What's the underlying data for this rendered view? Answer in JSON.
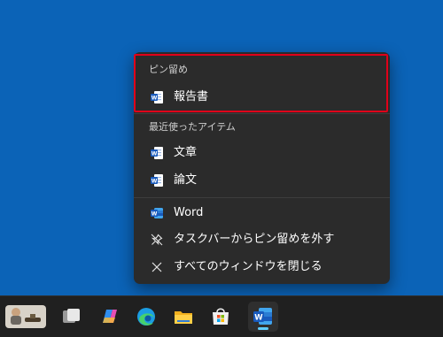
{
  "jumplist": {
    "pinned_header": "ピン留め",
    "pinned_items": [
      {
        "label": "報告書",
        "icon": "word-document-icon"
      }
    ],
    "recent_header": "最近使ったアイテム",
    "recent_items": [
      {
        "label": "文章",
        "icon": "word-document-icon"
      },
      {
        "label": "論文",
        "icon": "word-document-icon"
      }
    ],
    "app_label": "Word",
    "unpin_label": "タスクバーからピン留めを外す",
    "close_all_label": "すべてのウィンドウを閉じる"
  },
  "taskbar": {
    "apps": [
      "widgets-weather",
      "task-view",
      "copilot",
      "edge",
      "file-explorer",
      "microsoft-store",
      "word"
    ],
    "active_app": "word"
  },
  "colors": {
    "desktop": "#0b63b7",
    "menu_bg": "#2b2b2b",
    "highlight_border": "#e0001a",
    "taskbar": "#202020",
    "word_blue": "#185abd",
    "active_indicator": "#60cdff"
  }
}
